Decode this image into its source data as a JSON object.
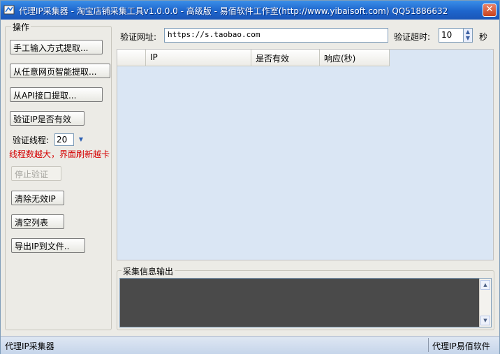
{
  "window": {
    "title": "代理IP采集器 - 淘宝店铺采集工具v1.0.0.0 - 高级版 - 易佰软件工作室(http://www.yibaisoft.com) QQ51886632",
    "close_label": "✕"
  },
  "left_panel": {
    "group_label": "操作",
    "btn_manual": "手工输入方式提取...",
    "btn_webpage": "从任意网页智能提取...",
    "btn_api": "从API接口提取...",
    "btn_verify": "验证IP是否有效",
    "threads_label": "验证线程:",
    "threads_value": "20",
    "threads_warning": "线程数越大，界面刷新越卡",
    "btn_stop": "停止验证",
    "btn_clear_invalid": "清除无效IP",
    "btn_clear_list": "清空列表",
    "btn_export": "导出IP到文件.."
  },
  "top": {
    "url_label": "验证网址:",
    "url_value": "https://s.taobao.com",
    "timeout_label": "验证超时:",
    "timeout_value": "10",
    "timeout_unit": "秒"
  },
  "table": {
    "columns": [
      "",
      "IP",
      "是否有效",
      "响应(秒)"
    ]
  },
  "output": {
    "label": "采集信息输出"
  },
  "status": {
    "left": "代理IP采集器",
    "right": "代理IP易佰软件"
  }
}
